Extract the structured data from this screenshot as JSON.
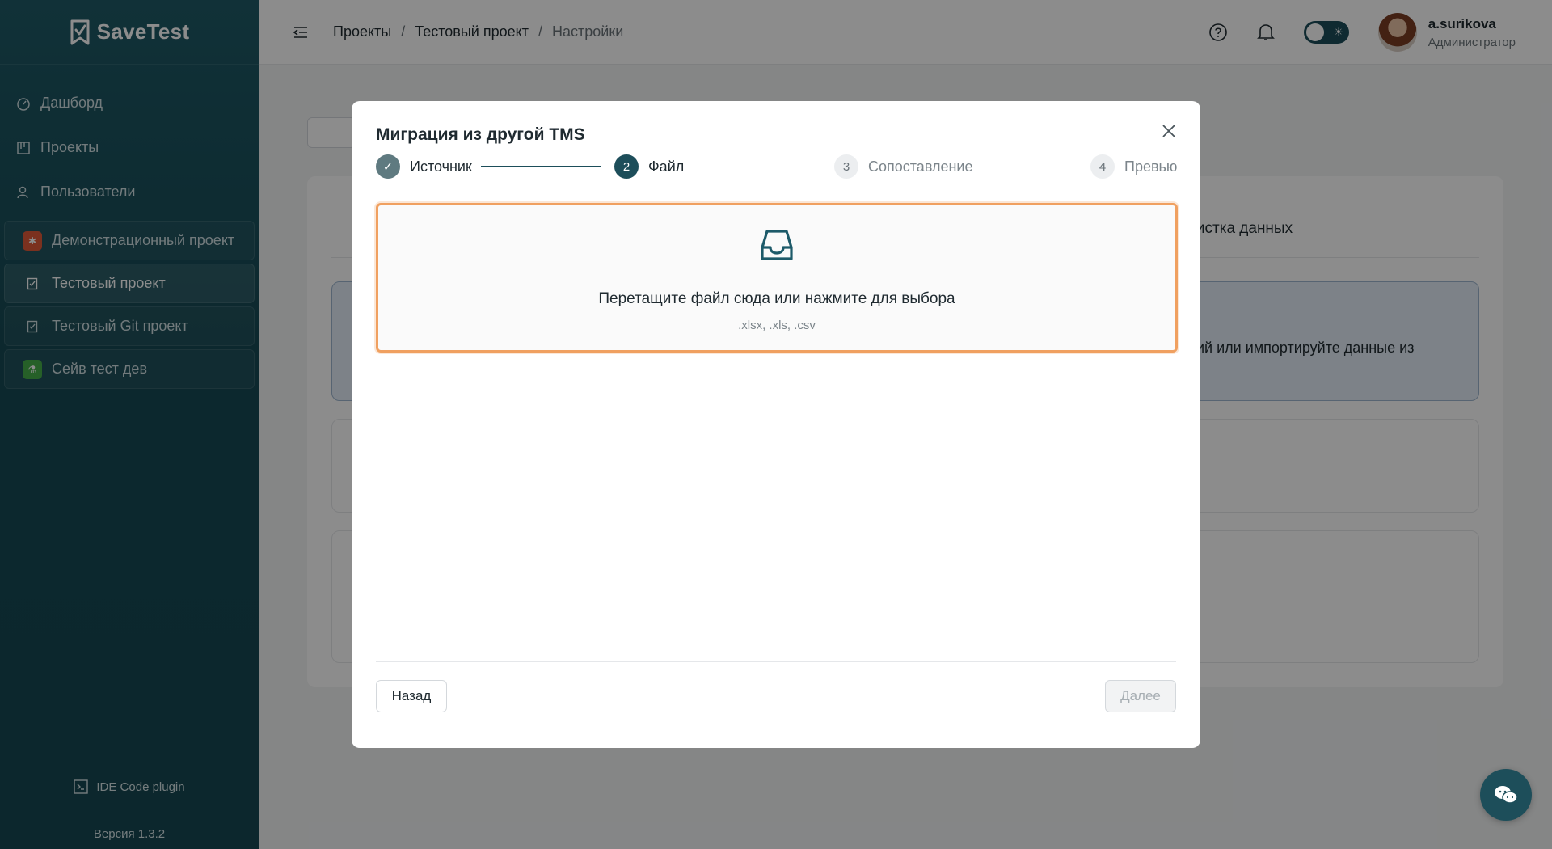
{
  "app": {
    "name": "SaveTest"
  },
  "sidebar": {
    "nav": [
      {
        "label": "Дашборд",
        "icon": "dashboard-icon"
      },
      {
        "label": "Проекты",
        "icon": "projects-icon"
      },
      {
        "label": "Пользователи",
        "icon": "users-icon"
      }
    ],
    "projects": [
      {
        "label": "Демонстрационный проект",
        "icon": "bug-icon",
        "color": "#e05a3a",
        "active": false
      },
      {
        "label": "Тестовый проект",
        "icon": "checklist-icon",
        "color": "transparent",
        "active": true
      },
      {
        "label": "Тестовый Git проект",
        "icon": "checklist-icon",
        "color": "transparent",
        "active": false
      },
      {
        "label": "Сейв тест дев",
        "icon": "flask-icon",
        "color": "#46b04a",
        "active": false
      }
    ],
    "plugin_label": "IDE Code plugin",
    "version": "Версия 1.3.2"
  },
  "header": {
    "breadcrumb": [
      "Проекты",
      "/",
      "Тестовый проект",
      "/",
      "Настройки"
    ],
    "user": {
      "name": "a.surikova",
      "role": "Администратор"
    }
  },
  "background": {
    "tab_partial": "чистка данных",
    "info_partial": "ий или импортируйте данные из"
  },
  "modal": {
    "title": "Миграция из другой TMS",
    "steps": [
      {
        "number": "✓",
        "label": "Источник",
        "status": "done"
      },
      {
        "number": "2",
        "label": "Файл",
        "status": "active"
      },
      {
        "number": "3",
        "label": "Сопоставление",
        "status": "wait"
      },
      {
        "number": "4",
        "label": "Превью",
        "status": "wait"
      }
    ],
    "dropzone": {
      "text": "Перетащите файл сюда или нажмите для выбора",
      "formats": ".xlsx, .xls, .csv"
    },
    "back_label": "Назад",
    "next_label": "Далее"
  },
  "colors": {
    "accent": "#1d4e5a",
    "highlight": "#f0a060"
  }
}
